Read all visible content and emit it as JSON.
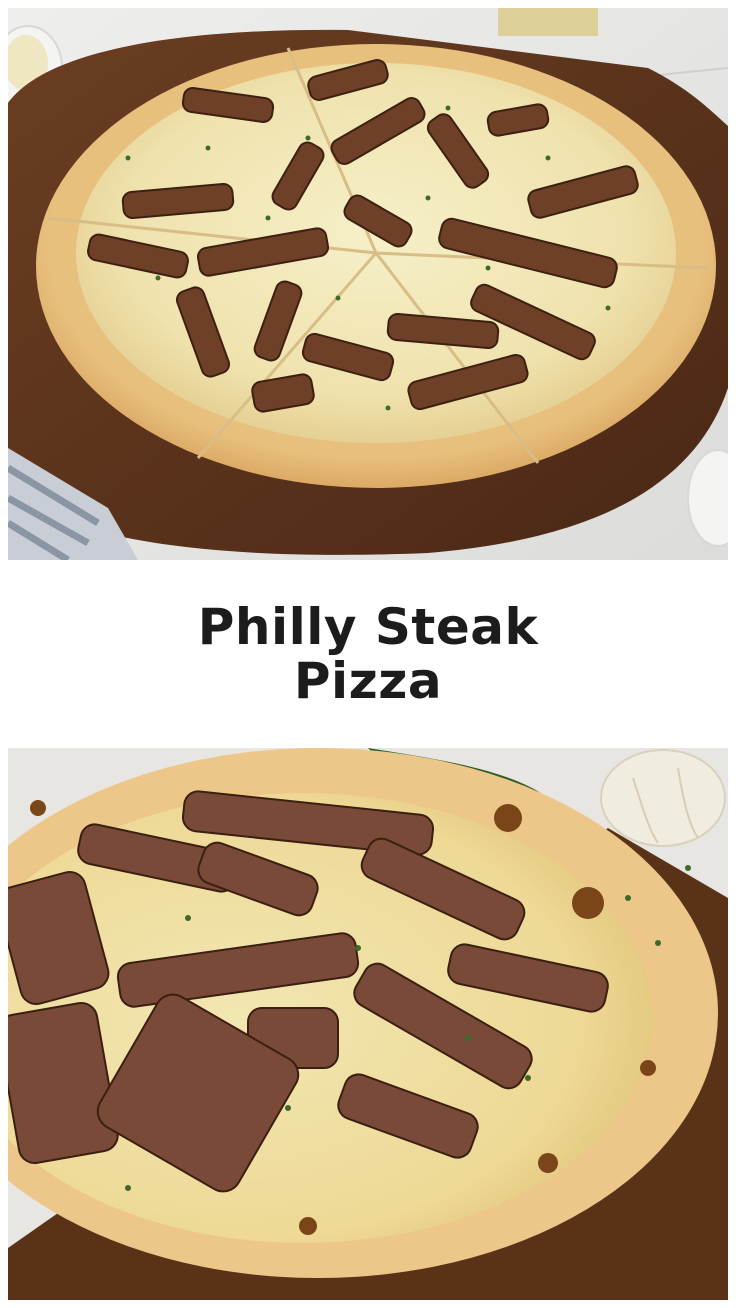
{
  "title": {
    "line1": "Philly Steak",
    "line2": "Pizza"
  }
}
